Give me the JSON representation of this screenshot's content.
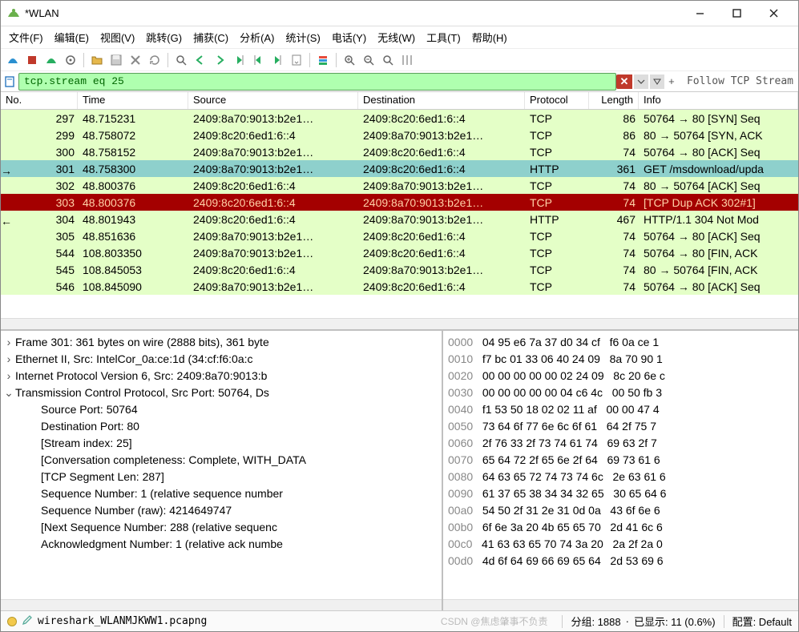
{
  "window": {
    "title": "*WLAN"
  },
  "menu": {
    "file": "文件(F)",
    "edit": "编辑(E)",
    "view": "视图(V)",
    "go": "跳转(G)",
    "capture": "捕获(C)",
    "analyze": "分析(A)",
    "statistics": "统计(S)",
    "telephony": "电话(Y)",
    "wireless": "无线(W)",
    "tools": "工具(T)",
    "help": "帮助(H)"
  },
  "filter": {
    "value": "tcp.stream eq 25",
    "follow_label": "Follow TCP Stream",
    "plus": "+"
  },
  "columns": {
    "no": "No.",
    "time": "Time",
    "source": "Source",
    "destination": "Destination",
    "protocol": "Protocol",
    "length": "Length",
    "info": "Info"
  },
  "rows": [
    {
      "no": "297",
      "time": "48.715231",
      "src": "2409:8a70:9013:b2e1…",
      "dst": "2409:8c20:6ed1:6::4",
      "proto": "TCP",
      "len": "86",
      "info": "50764 → 80 [SYN] Seq",
      "cls": "g"
    },
    {
      "no": "299",
      "time": "48.758072",
      "src": "2409:8c20:6ed1:6::4",
      "dst": "2409:8a70:9013:b2e1…",
      "proto": "TCP",
      "len": "86",
      "info": "80 → 50764 [SYN, ACK",
      "cls": "g"
    },
    {
      "no": "300",
      "time": "48.758152",
      "src": "2409:8a70:9013:b2e1…",
      "dst": "2409:8c20:6ed1:6::4",
      "proto": "TCP",
      "len": "74",
      "info": "50764 → 80 [ACK] Seq",
      "cls": "g"
    },
    {
      "no": "301",
      "time": "48.758300",
      "src": "2409:8a70:9013:b2e1…",
      "dst": "2409:8c20:6ed1:6::4",
      "proto": "HTTP",
      "len": "361",
      "info": "GET /msdownload/upda",
      "cls": "sel",
      "marker": "→"
    },
    {
      "no": "302",
      "time": "48.800376",
      "src": "2409:8c20:6ed1:6::4",
      "dst": "2409:8a70:9013:b2e1…",
      "proto": "TCP",
      "len": "74",
      "info": "80 → 50764 [ACK] Seq",
      "cls": "g"
    },
    {
      "no": "303",
      "time": "48.800376",
      "src": "2409:8c20:6ed1:6::4",
      "dst": "2409:8a70:9013:b2e1…",
      "proto": "TCP",
      "len": "74",
      "info": "[TCP Dup ACK 302#1]",
      "cls": "red"
    },
    {
      "no": "304",
      "time": "48.801943",
      "src": "2409:8c20:6ed1:6::4",
      "dst": "2409:8a70:9013:b2e1…",
      "proto": "HTTP",
      "len": "467",
      "info": "HTTP/1.1 304 Not Mod",
      "cls": "g",
      "marker": "←"
    },
    {
      "no": "305",
      "time": "48.851636",
      "src": "2409:8a70:9013:b2e1…",
      "dst": "2409:8c20:6ed1:6::4",
      "proto": "TCP",
      "len": "74",
      "info": "50764 → 80 [ACK] Seq",
      "cls": "g"
    },
    {
      "no": "544",
      "time": "108.803350",
      "src": "2409:8a70:9013:b2e1…",
      "dst": "2409:8c20:6ed1:6::4",
      "proto": "TCP",
      "len": "74",
      "info": "50764 → 80 [FIN, ACK",
      "cls": "g"
    },
    {
      "no": "545",
      "time": "108.845053",
      "src": "2409:8c20:6ed1:6::4",
      "dst": "2409:8a70:9013:b2e1…",
      "proto": "TCP",
      "len": "74",
      "info": "80 → 50764 [FIN, ACK",
      "cls": "g"
    },
    {
      "no": "546",
      "time": "108.845090",
      "src": "2409:8a70:9013:b2e1…",
      "dst": "2409:8c20:6ed1:6::4",
      "proto": "TCP",
      "len": "74",
      "info": "50764 → 80 [ACK] Seq",
      "cls": "g"
    }
  ],
  "tree": [
    {
      "tw": ">",
      "txt": "Frame 301: 361 bytes on wire (2888 bits), 361 byte"
    },
    {
      "tw": ">",
      "txt": "Ethernet II, Src: IntelCor_0a:ce:1d (34:cf:f6:0a:c"
    },
    {
      "tw": ">",
      "txt": "Internet Protocol Version 6, Src: 2409:8a70:9013:b"
    },
    {
      "tw": "v",
      "txt": "Transmission Control Protocol, Src Port: 50764, Ds"
    },
    {
      "ind": true,
      "txt": "Source Port: 50764"
    },
    {
      "ind": true,
      "txt": "Destination Port: 80"
    },
    {
      "ind": true,
      "txt": "[Stream index: 25]"
    },
    {
      "ind": true,
      "txt": "[Conversation completeness: Complete, WITH_DATA"
    },
    {
      "ind": true,
      "txt": "[TCP Segment Len: 287]"
    },
    {
      "ind": true,
      "txt": "Sequence Number: 1    (relative sequence number"
    },
    {
      "ind": true,
      "txt": "Sequence Number (raw): 4214649747"
    },
    {
      "ind": true,
      "txt": "[Next Sequence Number: 288    (relative sequenc"
    },
    {
      "ind": true,
      "txt": "Acknowledgment Number: 1    (relative ack numbe"
    }
  ],
  "hex": [
    {
      "off": "0000",
      "b": "04 95 e6 7a 37 d0 34 cf   f6 0a ce 1"
    },
    {
      "off": "0010",
      "b": "f7 bc 01 33 06 40 24 09   8a 70 90 1"
    },
    {
      "off": "0020",
      "b": "00 00 00 00 00 02 24 09   8c 20 6e c"
    },
    {
      "off": "0030",
      "b": "00 00 00 00 00 04 c6 4c   00 50 fb 3"
    },
    {
      "off": "0040",
      "b": "f1 53 50 18 02 02 11 af   00 00 47 4"
    },
    {
      "off": "0050",
      "b": "73 64 6f 77 6e 6c 6f 61   64 2f 75 7"
    },
    {
      "off": "0060",
      "b": "2f 76 33 2f 73 74 61 74   69 63 2f 7"
    },
    {
      "off": "0070",
      "b": "65 64 72 2f 65 6e 2f 64   69 73 61 6"
    },
    {
      "off": "0080",
      "b": "64 63 65 72 74 73 74 6c   2e 63 61 6"
    },
    {
      "off": "0090",
      "b": "61 37 65 38 34 34 32 65   30 65 64 6"
    },
    {
      "off": "00a0",
      "b": "54 50 2f 31 2e 31 0d 0a   43 6f 6e 6"
    },
    {
      "off": "00b0",
      "b": "6f 6e 3a 20 4b 65 65 70   2d 41 6c 6"
    },
    {
      "off": "00c0",
      "b": "41 63 63 65 70 74 3a 20   2a 2f 2a 0"
    },
    {
      "off": "00d0",
      "b": "4d 6f 64 69 66 69 65 64   2d 53 69 6"
    }
  ],
  "status": {
    "file": "wireshark_WLANMJKWW1.pcapng",
    "packets": "分组: 1888",
    "displayed": "已显示: 11 (0.6%)",
    "profile": "配置: Default",
    "watermark": "CSDN @焦虑肇事不负责"
  }
}
